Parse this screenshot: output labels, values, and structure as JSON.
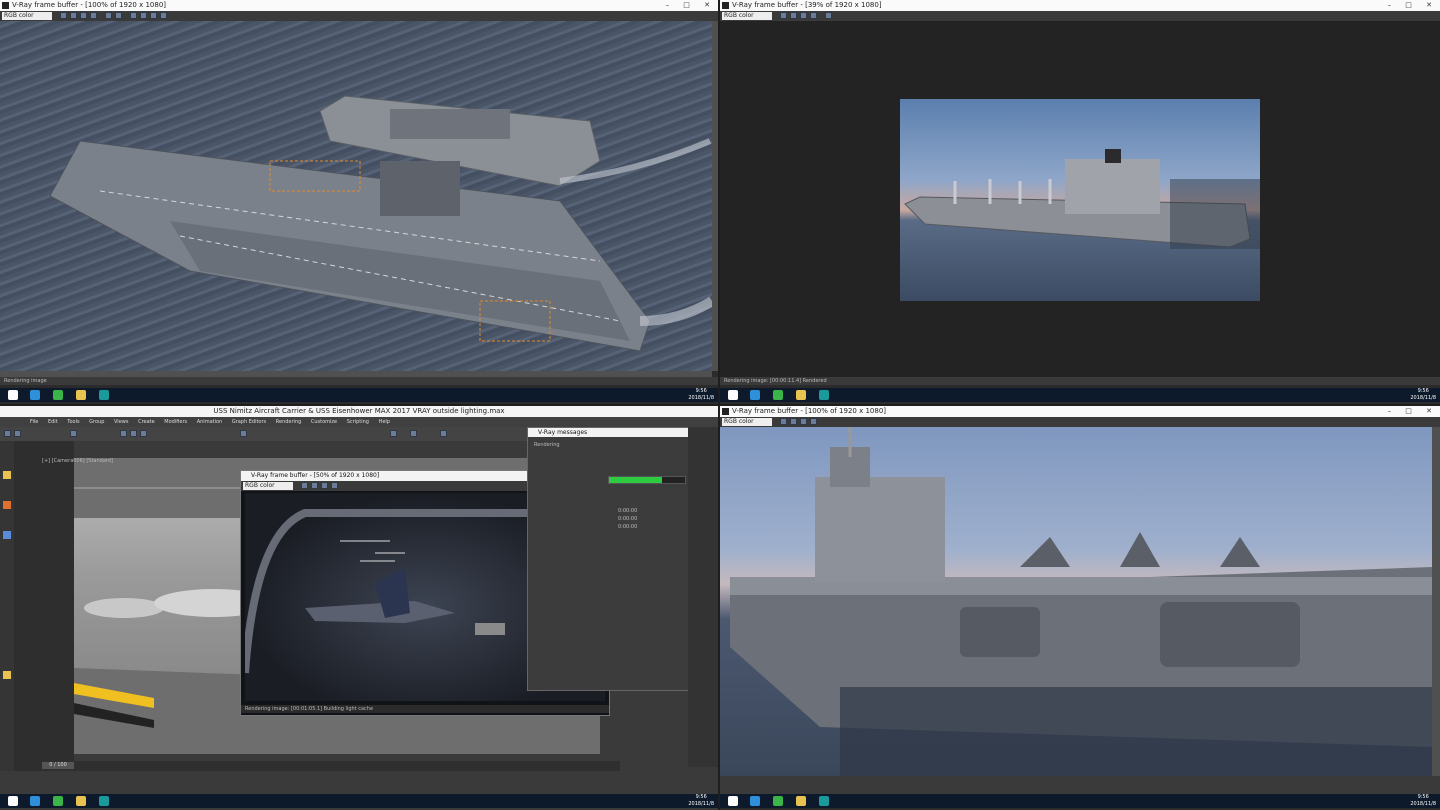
{
  "windows": {
    "top_left": {
      "title": "V-Ray frame buffer - [100% of 1920 x 1080]",
      "channel": "RGB color",
      "status": "Rendering image"
    },
    "top_right": {
      "title": "V-Ray frame buffer - [39% of 1920 x 1080]",
      "channel": "RGB color",
      "status": "Rendering image: [00:00:11.4] Rendered"
    },
    "bottom_left": {
      "app_title": "USS Nimitz Aircraft Carrier & USS Eisenhower MAX 2017 VRAY outside lighting.max",
      "menu": [
        "File",
        "Edit",
        "Tools",
        "Group",
        "Views",
        "Create",
        "Modifiers",
        "Animation",
        "Graph Editors",
        "Rendering",
        "Customize",
        "Scripting",
        "Help"
      ],
      "viewport_label": "[+] [Camera006] [Standard]",
      "vfb_title": "V-Ray frame buffer - [50% of 1920 x 1080]",
      "vfb_channel": "RGB color",
      "vfb_status": "Rendering image: [00:01:05.1] Building light cache",
      "progress_title": "V-Ray messages",
      "progress_tab": "Rendering",
      "progress_values": [
        "0:00:00",
        "0:00:00",
        "0:00:00"
      ],
      "progress_fraction": 0.7,
      "frame_counter": "0 / 100"
    },
    "bottom_right": {
      "title": "V-Ray frame buffer - [100% of 1920 x 1080]",
      "channel": "RGB color"
    }
  },
  "taskbar": {
    "clock_time": "9:56",
    "clock_date": "2018/11/8"
  },
  "colors": {
    "taskbar": "#0c1a2c",
    "progress_green": "#2ecc40",
    "titlebar": "#fafafa"
  }
}
